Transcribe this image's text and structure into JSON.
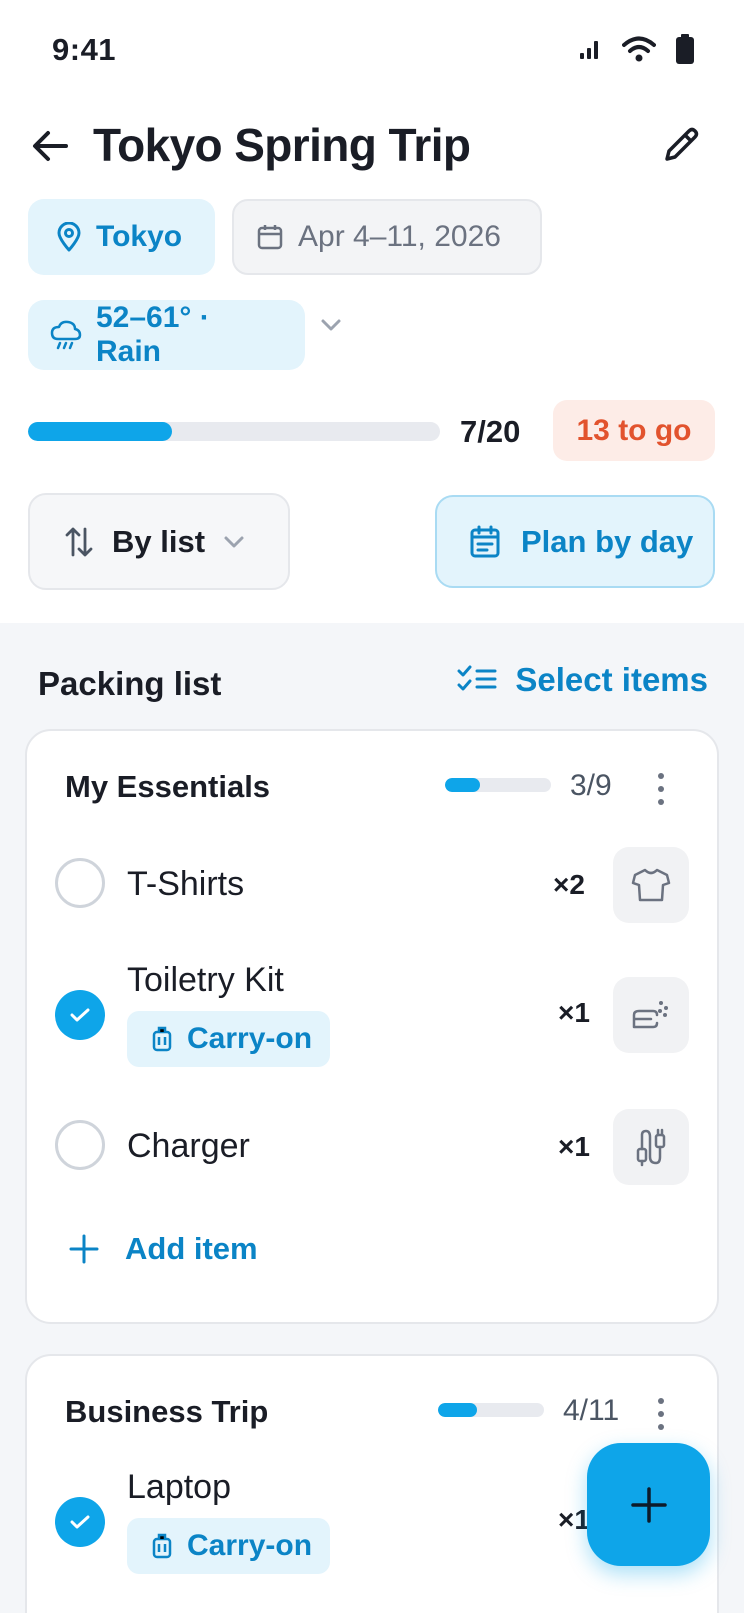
{
  "status": {
    "time": "9:41"
  },
  "header": {
    "title": "Tokyo Spring Trip"
  },
  "trip": {
    "location": "Tokyo",
    "dates": "Apr 4–11, 2026",
    "weather": "52–61° · Rain"
  },
  "progress": {
    "packed": 7,
    "total": 20,
    "fraction": 0.35,
    "count_label": "7/20",
    "remaining_label": "13 to go"
  },
  "controls": {
    "sort_label": "By list",
    "plan_label": "Plan by day"
  },
  "packing": {
    "title": "Packing list",
    "select_label": "Select items",
    "add_item_label": "Add item",
    "lists": [
      {
        "name": "My Essentials",
        "count_label": "3/9",
        "fraction": 0.333,
        "items": [
          {
            "name": "T-Shirts",
            "qty": "×2",
            "checked": false,
            "icon": "tshirt-icon"
          },
          {
            "name": "Toiletry Kit",
            "qty": "×1",
            "checked": true,
            "tag": "Carry-on",
            "icon": "soap-icon"
          },
          {
            "name": "Charger",
            "qty": "×1",
            "checked": false,
            "icon": "cable-icon"
          }
        ]
      },
      {
        "name": "Business Trip",
        "count_label": "4/11",
        "fraction": 0.364,
        "items": [
          {
            "name": "Laptop",
            "qty": "×1",
            "checked": true,
            "tag": "Carry-on"
          }
        ]
      }
    ]
  },
  "colors": {
    "accent": "#0ea5e9",
    "accent_text": "#0b84c6",
    "warning_text": "#e2532e",
    "warning_bg": "#fdece7"
  }
}
